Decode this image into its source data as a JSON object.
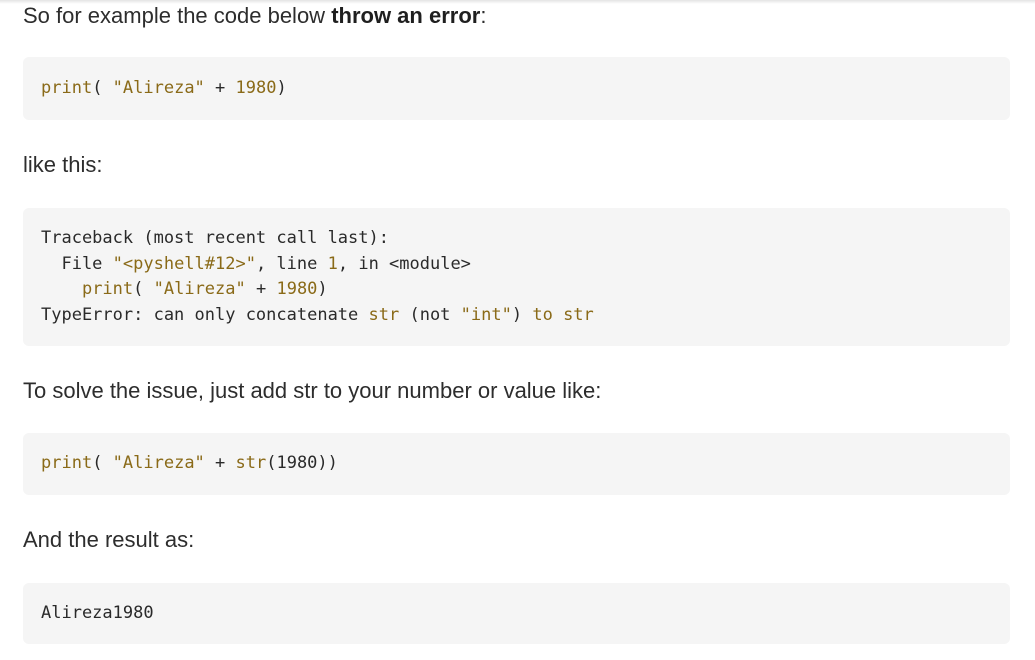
{
  "paragraph_1": {
    "before": "So for example the code below ",
    "bold": "throw an error",
    "after": ":"
  },
  "code_1": {
    "func": "print",
    "open": "( ",
    "string": "\"Alireza\"",
    "op": " + ",
    "number": "1980",
    "close": ")"
  },
  "paragraph_2": "like this:",
  "code_2": {
    "line_1": "Traceback (most recent call last):",
    "line_2_prefix": "  File ",
    "line_2_string": "\"<pyshell#12>\"",
    "line_2_mid": ", line ",
    "line_2_number": "1",
    "line_2_suffix": ", in <module>",
    "line_3_indent": "    ",
    "line_3_func": "print",
    "line_3_open": "( ",
    "line_3_string": "\"Alireza\"",
    "line_3_op": " + ",
    "line_3_number": "1980",
    "line_3_close": ")",
    "line_4_prefix": "TypeError: can only concatenate ",
    "line_4_str1": "str",
    "line_4_mid1": " (not ",
    "line_4_string": "\"int\"",
    "line_4_mid2": ") ",
    "line_4_to": "to",
    "line_4_space": " ",
    "line_4_str2": "str"
  },
  "paragraph_3": "To solve the issue, just add str to your number or value like:",
  "code_3": {
    "func": "print",
    "open": "( ",
    "string": "\"Alireza\"",
    "op": " + ",
    "str_func": "str",
    "arg": "(1980))"
  },
  "paragraph_4": "And the result as:",
  "code_4": {
    "output": "Alireza1980"
  },
  "colors": {
    "background": "#ffffff",
    "code_background": "#f5f5f5",
    "syntax_gold": "#8a6a18",
    "text": "#2d2d2d"
  }
}
